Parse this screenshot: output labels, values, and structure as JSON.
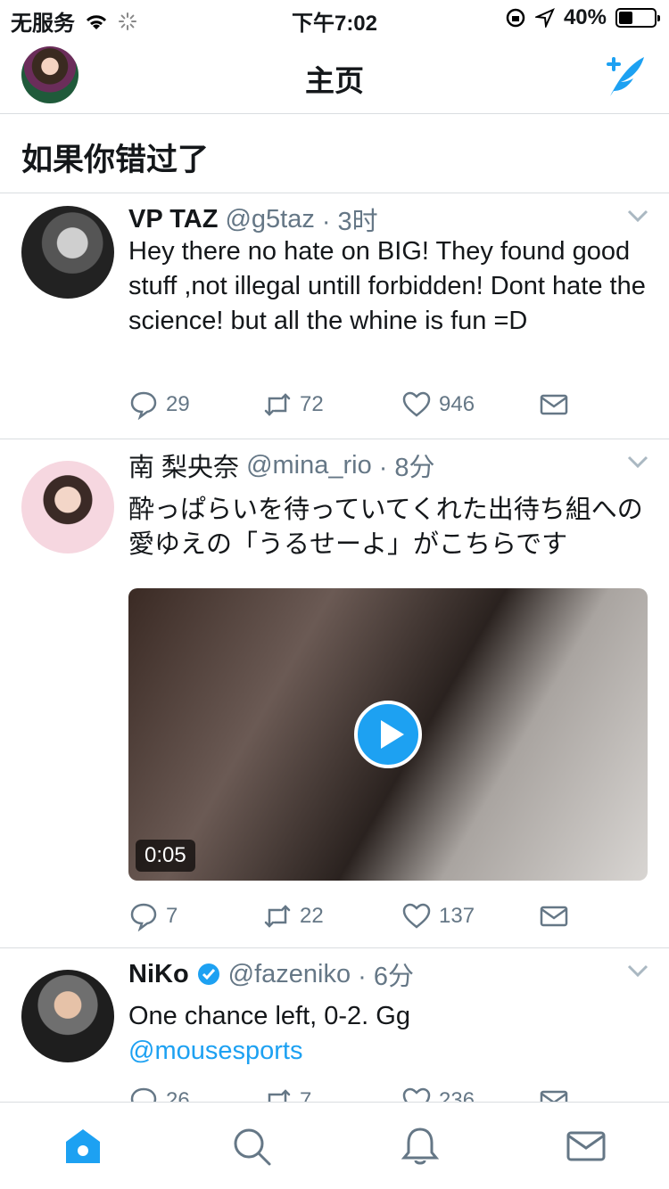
{
  "status_bar": {
    "carrier": "无服务",
    "time": "下午7:02",
    "battery": "40%",
    "battery_level": 0.4
  },
  "nav": {
    "title": "主页"
  },
  "section": {
    "title": "如果你错过了"
  },
  "tweets": [
    {
      "name": "VP TAZ",
      "handle": "@g5taz",
      "time": "· 3时",
      "verified": false,
      "text": "Hey there no hate on BIG! They found good stuff ,not illegal untill forbidden! Dont hate the science! but all the whine is fun =D",
      "replies": "29",
      "retweets": "72",
      "likes": "946"
    },
    {
      "name": "南 梨央奈",
      "handle": "@mina_rio",
      "time": "· 8分",
      "verified": false,
      "text": "酔っぱらいを待っていてくれた出待ち組への愛ゆえの「うるせーよ」がこちらです",
      "media": {
        "type": "video",
        "duration": "0:05"
      },
      "replies": "7",
      "retweets": "22",
      "likes": "137"
    },
    {
      "name": "NiKo",
      "handle": "@fazeniko",
      "time": "· 6分",
      "verified": true,
      "text": "One chance left, 0-2. Gg",
      "link": "@mousesports",
      "replies": "26",
      "retweets": "7",
      "likes": "236"
    }
  ],
  "tab_bar": {
    "items": [
      "home-icon",
      "search-icon",
      "notifications-icon",
      "messages-icon"
    ],
    "active": "home-icon"
  },
  "colors": {
    "accent": "#1da1f2",
    "secondary_text": "#657786",
    "divider": "#d9dde0"
  }
}
